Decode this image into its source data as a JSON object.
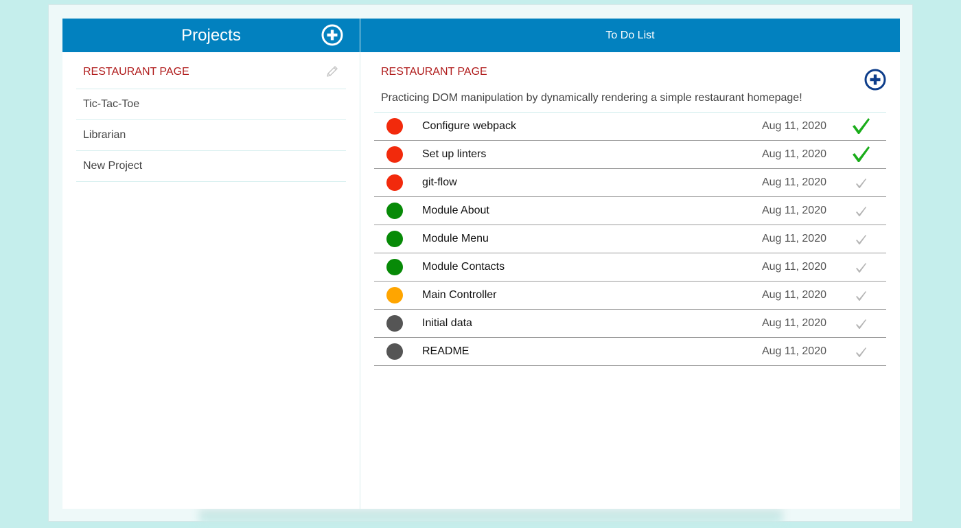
{
  "projects_panel": {
    "title": "Projects",
    "add_icon": "plus-circle-icon",
    "items": [
      {
        "label": "RESTAURANT PAGE",
        "active": true
      },
      {
        "label": "Tic-Tac-Toe",
        "active": false
      },
      {
        "label": "Librarian",
        "active": false
      },
      {
        "label": "New Project",
        "active": false
      }
    ],
    "edit_icon": "pencil-icon"
  },
  "todo_panel": {
    "title": "To Do List",
    "project_title": "RESTAURANT PAGE",
    "project_description": "Practicing DOM manipulation by dynamically rendering a simple restaurant homepage!",
    "add_icon": "plus-circle-icon",
    "items": [
      {
        "name": "Configure webpack",
        "date": "Aug 11, 2020",
        "priority_color": "#f22a0c",
        "done": true
      },
      {
        "name": "Set up linters",
        "date": "Aug 11, 2020",
        "priority_color": "#f22a0c",
        "done": true
      },
      {
        "name": "git-flow",
        "date": "Aug 11, 2020",
        "priority_color": "#f22a0c",
        "done": false
      },
      {
        "name": "Module About",
        "date": "Aug 11, 2020",
        "priority_color": "#078a07",
        "done": false
      },
      {
        "name": "Module Menu",
        "date": "Aug 11, 2020",
        "priority_color": "#078a07",
        "done": false
      },
      {
        "name": "Module Contacts",
        "date": "Aug 11, 2020",
        "priority_color": "#078a07",
        "done": false
      },
      {
        "name": "Main Controller",
        "date": "Aug 11, 2020",
        "priority_color": "#ffa500",
        "done": false
      },
      {
        "name": "Initial data",
        "date": "Aug 11, 2020",
        "priority_color": "#555555",
        "done": false
      },
      {
        "name": "README",
        "date": "Aug 11, 2020",
        "priority_color": "#555555",
        "done": false
      }
    ]
  },
  "colors": {
    "header_bg": "#0281bf",
    "active_text": "#b01c1c",
    "check_done": "#1aad1a",
    "check_pending": "#b5b5b5",
    "add_icon_dark": "#0d3d8a"
  }
}
